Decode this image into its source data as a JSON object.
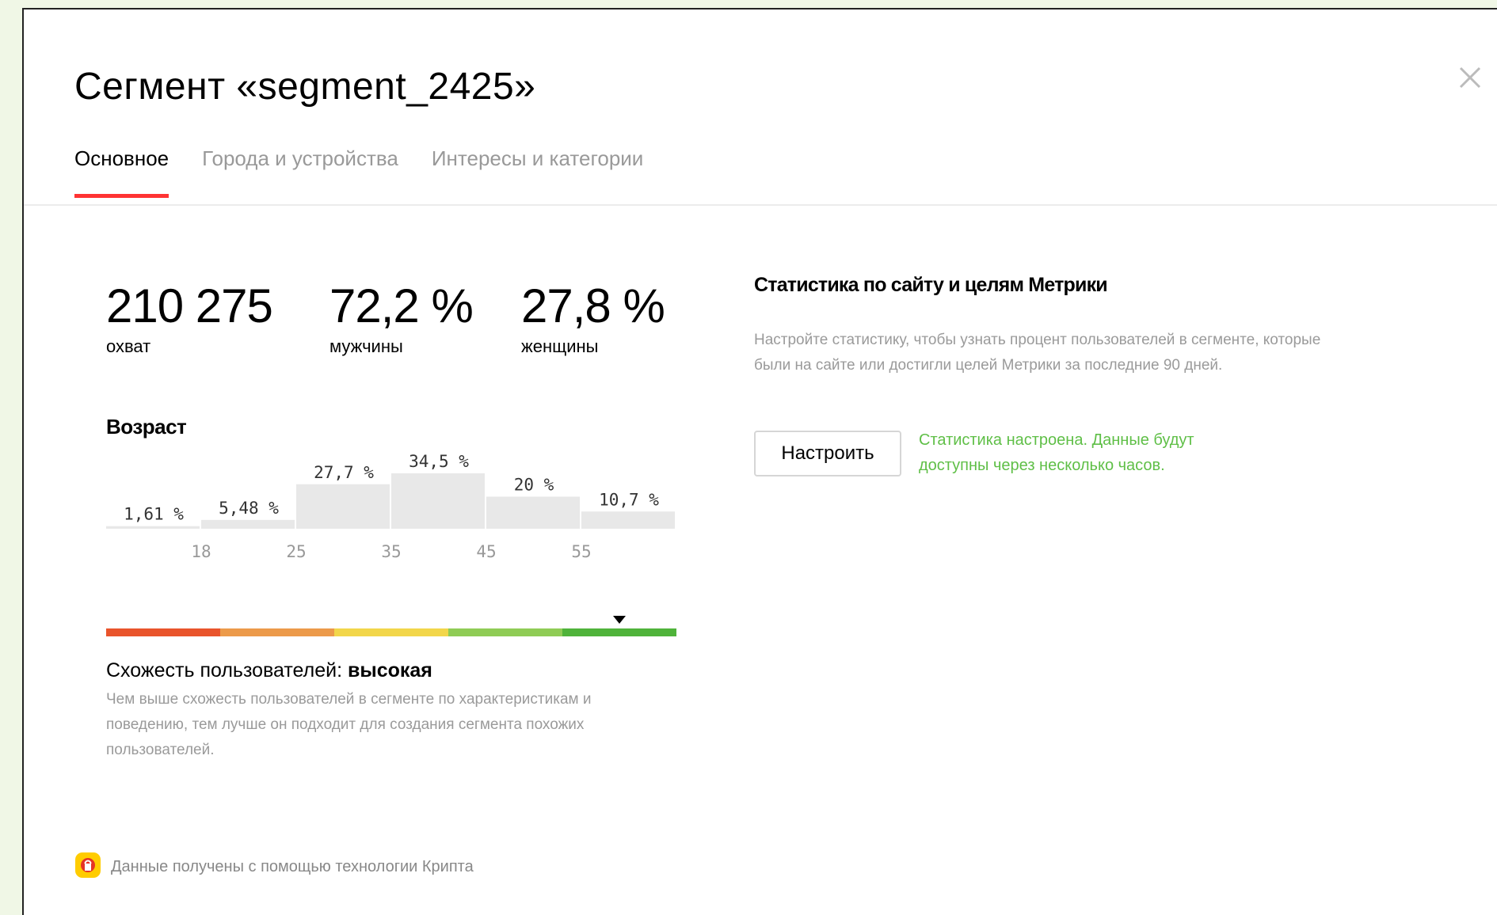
{
  "header": {
    "title": "Сегмент «segment_2425»",
    "close_icon": "close-icon"
  },
  "tabs": [
    {
      "label": "Основное",
      "active": true
    },
    {
      "label": "Города и устройства",
      "active": false
    },
    {
      "label": "Интересы и категории",
      "active": false
    }
  ],
  "stats": [
    {
      "value": "210 275",
      "label": "охват"
    },
    {
      "value": "72,2 %",
      "label": "мужчины"
    },
    {
      "value": "27,8 %",
      "label": "женщины"
    }
  ],
  "age": {
    "title": "Возраст"
  },
  "chart_data": {
    "type": "bar",
    "categories": [
      "<18",
      "18–25",
      "25–35",
      "35–45",
      "45–55",
      "55+"
    ],
    "values": [
      1.61,
      5.48,
      27.7,
      34.5,
      20,
      10.7
    ],
    "value_labels": [
      "1,61 %",
      "5,48 %",
      "27,7 %",
      "34,5 %",
      "20 %",
      "10,7 %"
    ],
    "tick_labels": [
      "18",
      "25",
      "35",
      "45",
      "55"
    ],
    "bar_color": "#e8e8e8"
  },
  "similarity": {
    "colors": [
      "#e9542c",
      "#ec9a4a",
      "#f2d64a",
      "#8fcc55",
      "#4fb33a"
    ],
    "marker_fraction": 0.9,
    "label_prefix": "Схожесть пользователей: ",
    "level": "высокая",
    "description": "Чем выше схожесть пользователей в сегменте по характеристикам и поведению, тем лучше он подходит для создания сегмента похожих пользователей."
  },
  "metrika": {
    "title": "Статистика по сайту и целям Метрики",
    "description": "Настройте статистику, чтобы узнать процент пользователей в сегменте, которые были на сайте или достигли целей Метрики за последние 90 дней.",
    "setup_button": "Настроить",
    "status": "Статистика настроена. Данные будут доступны через несколько часов.",
    "status_color": "#5fbf47"
  },
  "footer": {
    "icon": "crypta-logo-icon",
    "text": "Данные получены с помощью технологии Крипта"
  }
}
